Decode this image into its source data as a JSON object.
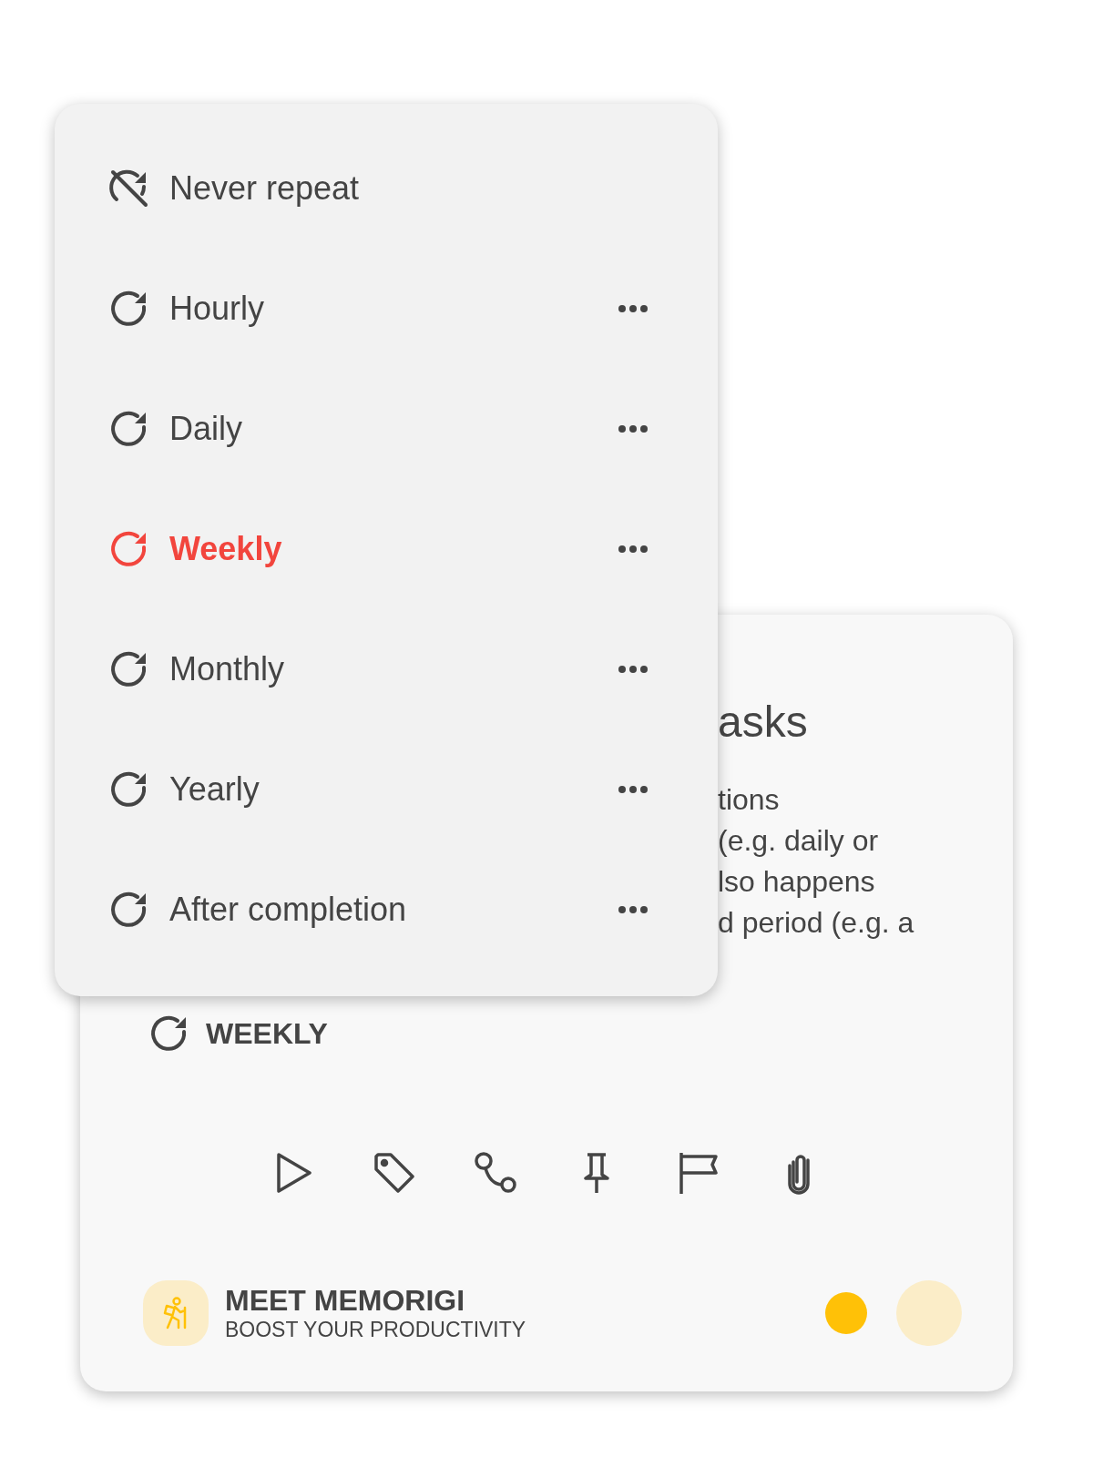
{
  "repeat_menu": {
    "items": [
      {
        "label": "Never repeat",
        "kind": "never",
        "selected": false,
        "more": false
      },
      {
        "label": "Hourly",
        "kind": "repeat",
        "selected": false,
        "more": true
      },
      {
        "label": "Daily",
        "kind": "repeat",
        "selected": false,
        "more": true
      },
      {
        "label": "Weekly",
        "kind": "repeat",
        "selected": true,
        "more": true
      },
      {
        "label": "Monthly",
        "kind": "repeat",
        "selected": false,
        "more": true
      },
      {
        "label": "Yearly",
        "kind": "repeat",
        "selected": false,
        "more": true
      },
      {
        "label": "After completion",
        "kind": "repeat",
        "selected": false,
        "more": true
      }
    ]
  },
  "task_card": {
    "title": "asks",
    "description_lines": [
      "tions",
      "(e.g. daily or",
      "lso happens",
      "d period (e.g. a"
    ],
    "repeat_label": "WEEKLY",
    "promo": {
      "title": "MEET MEMORIGI",
      "subtitle": "BOOST YOUR PRODUCTIVITY"
    }
  }
}
